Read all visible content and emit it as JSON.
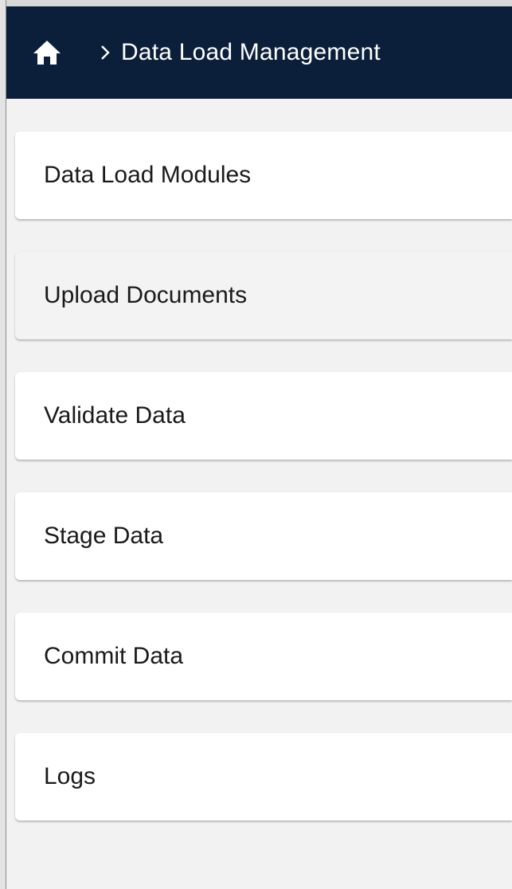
{
  "header": {
    "breadcrumb_title": "Data Load Management",
    "home_icon": "home-icon",
    "separator_icon": "chevron-right-icon",
    "background_color": "#0c1f3a"
  },
  "menu": {
    "items": [
      {
        "label": "Data Load Modules",
        "active": false
      },
      {
        "label": "Upload Documents",
        "active": true
      },
      {
        "label": "Validate Data",
        "active": false
      },
      {
        "label": "Stage Data",
        "active": false
      },
      {
        "label": "Commit Data",
        "active": false
      },
      {
        "label": "Logs",
        "active": false
      }
    ]
  }
}
